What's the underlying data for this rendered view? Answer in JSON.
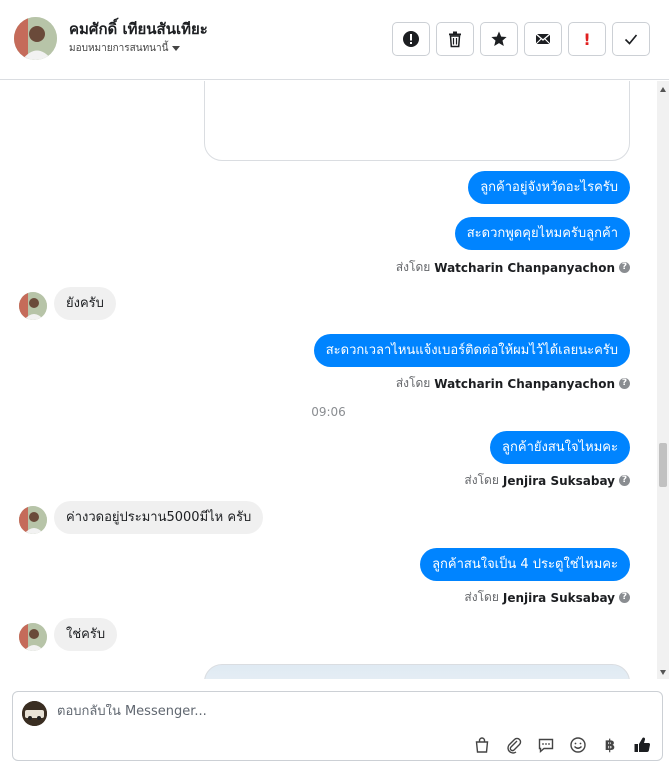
{
  "header": {
    "contact_name": "คมศักดิ์ เทียนสันเทียะ",
    "assign_label": "มอบหมายการสนทนานี้",
    "actions": [
      {
        "name": "spam-button",
        "icon": "exclamation-circle-icon"
      },
      {
        "name": "delete-button",
        "icon": "trash-icon"
      },
      {
        "name": "star-button",
        "icon": "star-icon"
      },
      {
        "name": "mark-unread-button",
        "icon": "envelope-icon"
      },
      {
        "name": "follow-up-button",
        "icon": "red-exclamation-icon",
        "label": "!"
      },
      {
        "name": "mark-done-button",
        "icon": "checkmark-icon"
      }
    ]
  },
  "messages": [
    {
      "dir": "out",
      "text": "ลูกค้าอยู่จังหวัดอะไรครับ"
    },
    {
      "dir": "out",
      "text": "สะดวกพูดคุยไหมครับลูกค้า"
    },
    {
      "dir": "sent_by",
      "prefix": "ส่งโดย",
      "name": "Watcharin Chanpanyachon"
    },
    {
      "dir": "in",
      "text": "ยังครับ"
    },
    {
      "dir": "out",
      "text": "สะดวกเวลาไหนแจ้งเบอร์ติดต่อให้ผมไว้ได้เลยนะครับ"
    },
    {
      "dir": "sent_by",
      "prefix": "ส่งโดย",
      "name": "Watcharin Chanpanyachon"
    },
    {
      "dir": "time",
      "text": "09:06"
    },
    {
      "dir": "out",
      "text": "ลูกค้ายังสนใจไหมคะ"
    },
    {
      "dir": "sent_by",
      "prefix": "ส่งโดย",
      "name": "Jenjira Suksabay"
    },
    {
      "dir": "in",
      "text": "ค่างวดอยู่ประมาน5000มีไห ครับ"
    },
    {
      "dir": "out",
      "text": "ลูกค้าสนใจเป็น 4 ประตูใช่ไหมคะ"
    },
    {
      "dir": "sent_by",
      "prefix": "ส่งโดย",
      "name": "Jenjira Suksabay"
    },
    {
      "dir": "in",
      "text": "ใช่ครับ"
    }
  ],
  "composer": {
    "placeholder": "ตอบกลับใน Messenger...",
    "tools": [
      "shopping-bag-icon",
      "paperclip-icon",
      "saved-reply-icon",
      "emoji-icon",
      "baht-icon",
      "thumbs-up-icon"
    ],
    "baht_symbol": "฿"
  },
  "colors": {
    "outgoing_bubble": "#0084ff",
    "incoming_bubble": "#f0f0f0"
  }
}
